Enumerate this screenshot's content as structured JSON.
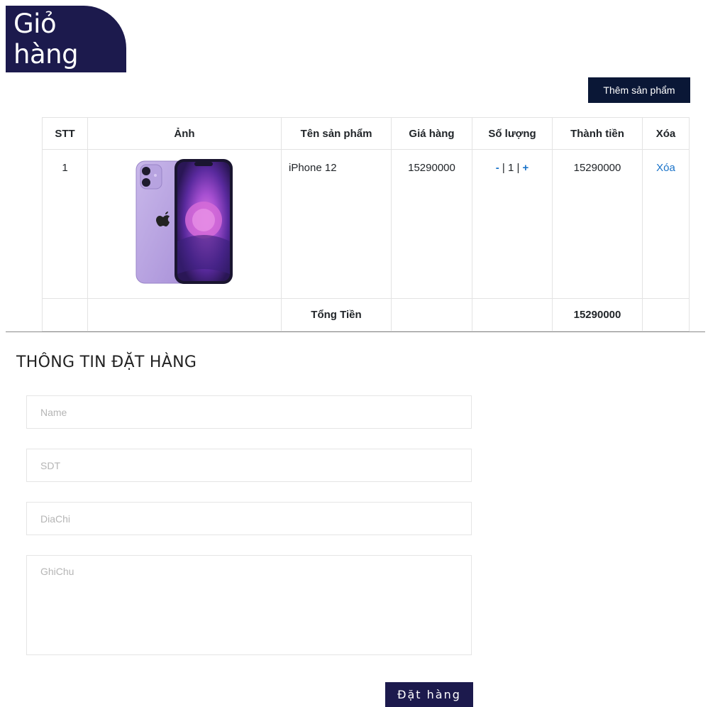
{
  "page": {
    "title": "Giỏ hàng"
  },
  "toolbar": {
    "add_product_label": "Thêm sản phẩm"
  },
  "cart": {
    "headers": [
      "STT",
      "Ảnh",
      "Tên sản phẩm",
      "Giá hàng",
      "Số lượng",
      "Thành tiền",
      "Xóa"
    ],
    "items": [
      {
        "stt": "1",
        "image_icon": "iphone-12-purple",
        "name": "iPhone 12",
        "price": "15290000",
        "qty_minus": "-",
        "qty_sep": "|",
        "quantity": "1",
        "qty_plus": "+",
        "subtotal": "15290000",
        "delete_label": "Xóa"
      }
    ],
    "total_label": "Tổng Tiền",
    "total_value": "15290000"
  },
  "order": {
    "heading": "THÔNG TIN ĐẶT HÀNG",
    "name_placeholder": "Name",
    "phone_placeholder": "SDT",
    "address_placeholder": "DiaChi",
    "note_placeholder": "GhiChu",
    "submit_label": "Đặt hàng"
  },
  "colors": {
    "navy": "#1c1a4d",
    "button_dark": "#0a1736",
    "link_blue": "#1a73c9"
  }
}
